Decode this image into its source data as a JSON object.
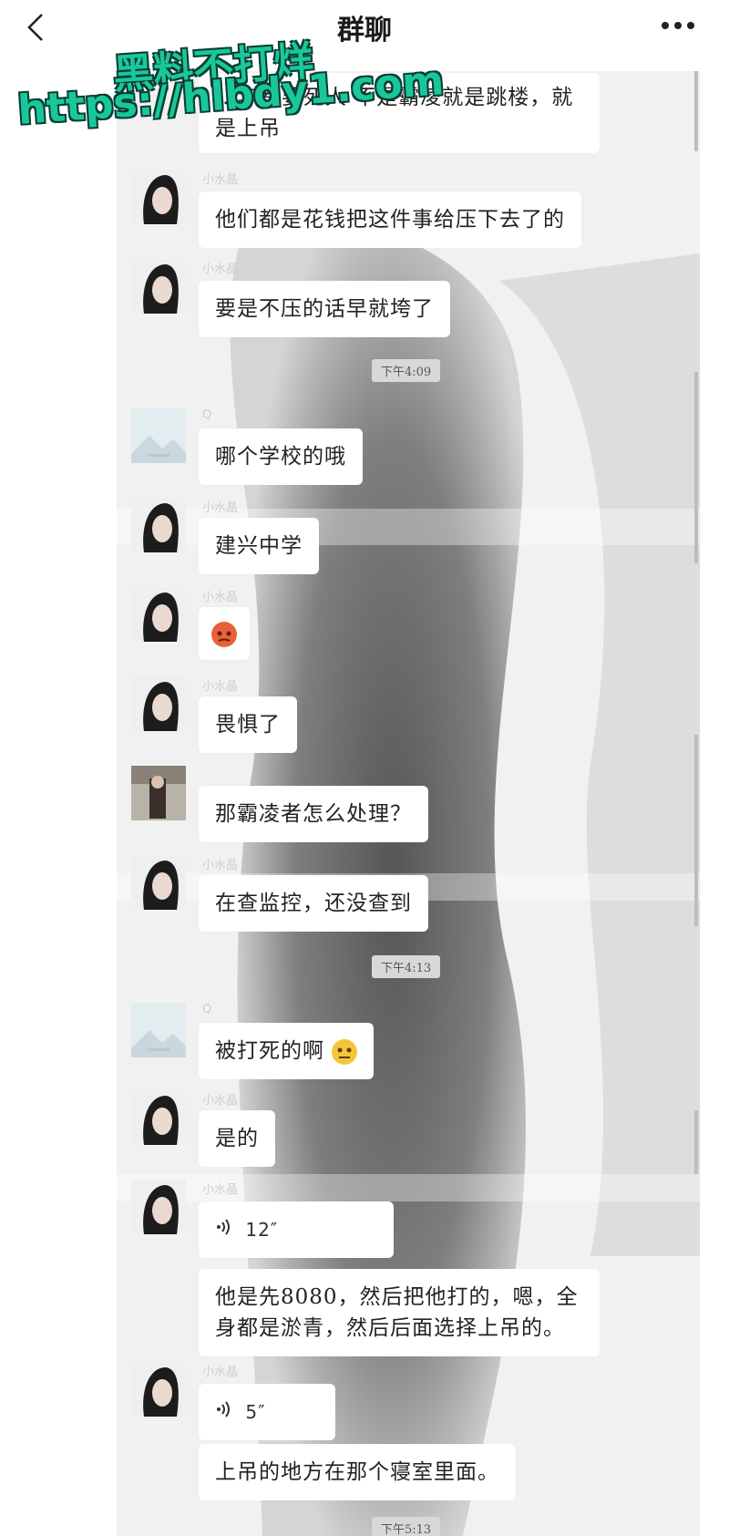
{
  "header": {
    "title": "群聊",
    "back_icon": "chevron-left-icon",
    "more_icon": "more-dots-icon"
  },
  "watermark": {
    "line1": "黑料不打烊",
    "line2": "https://hlbdy1.com"
  },
  "messages": [
    {
      "id": "m1",
      "sender": "",
      "text": "...年都要死人  不是霸凌就是跳楼，就是上吊"
    },
    {
      "id": "m2",
      "sender": "小水晶",
      "text": "他们都是花钱把这件事给压下去了的"
    },
    {
      "id": "m3",
      "sender": "小水晶",
      "text": "要是不压的话早就垮了"
    },
    {
      "id": "t1",
      "time": "下午4:09"
    },
    {
      "id": "m4",
      "sender": "Q",
      "text": "哪个学校的哦"
    },
    {
      "id": "m5",
      "sender": "小水晶",
      "text": "建兴中学"
    },
    {
      "id": "m6",
      "sender": "小水晶",
      "text": ""
    },
    {
      "id": "m7",
      "sender": "小水晶",
      "text": "畏惧了"
    },
    {
      "id": "m8",
      "sender": "",
      "text": "那霸凌者怎么处理？"
    },
    {
      "id": "m9",
      "sender": "小水晶",
      "text": "在查监控，还没查到"
    },
    {
      "id": "t2",
      "time": "下午4:13"
    },
    {
      "id": "m10",
      "sender": "Q",
      "text": "被打死的啊"
    },
    {
      "id": "m11",
      "sender": "小水晶",
      "text": "是的"
    },
    {
      "id": "m12",
      "sender": "小水晶",
      "voice": "12″",
      "text": "他是先8080，然后把他打的，嗯，全身都是淤青，然后后面选择上吊的。"
    },
    {
      "id": "m13",
      "sender": "小水晶",
      "voice": "5″",
      "text": "上吊的地方在那个寝室里面。"
    },
    {
      "id": "t3",
      "time": "下午5:13"
    }
  ],
  "colors": {
    "watermark_fill": "#19c79a",
    "watermark_outline": "#0a3d33",
    "bubble": "#ffffff",
    "timestamp_bg": "#d8d8d8"
  }
}
